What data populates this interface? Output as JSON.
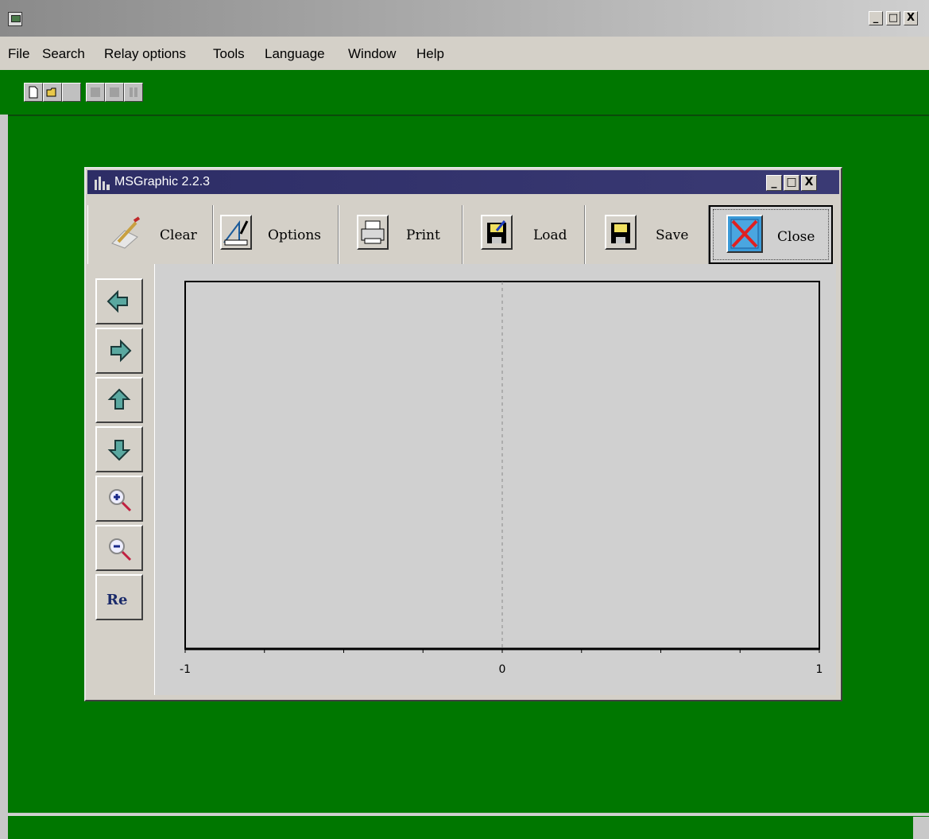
{
  "app": {
    "window_buttons": [
      "_",
      "□",
      "X"
    ],
    "menu": [
      "File",
      "Search",
      "Relay options",
      "Tools",
      "Language",
      "Window",
      "Help"
    ],
    "toolbar_icons": [
      "new-document-icon",
      "open-folder-icon",
      "save-disabled-icon",
      "disabled-tool-icon",
      "disabled-tool-icon",
      "disabled-tool-icon"
    ],
    "background_color": "#007700"
  },
  "child_window": {
    "title": "MSGraphic 2.2.3",
    "window_buttons": [
      "_",
      "□",
      "X"
    ],
    "commands": [
      {
        "label": "Clear",
        "icon": "clear-eraser-icon"
      },
      {
        "label": "Options",
        "icon": "options-ruler-icon"
      },
      {
        "label": "Print",
        "icon": "printer-icon"
      },
      {
        "label": "Load",
        "icon": "load-floppy-icon"
      },
      {
        "label": "Save",
        "icon": "save-floppy-icon"
      },
      {
        "label": "Close",
        "icon": "close-x-icon"
      }
    ],
    "nav_buttons": [
      "arrow-left-icon",
      "arrow-right-icon",
      "arrow-up-icon",
      "arrow-down-icon",
      "zoom-in-icon",
      "zoom-out-icon"
    ],
    "reset_label": "Re"
  },
  "chart_data": {
    "type": "line",
    "xlim": [
      -1,
      1
    ],
    "xticks": [
      "-1",
      "0",
      "1"
    ],
    "series": [],
    "grid": false,
    "zero_line": "dashed vertical at x = 0"
  }
}
